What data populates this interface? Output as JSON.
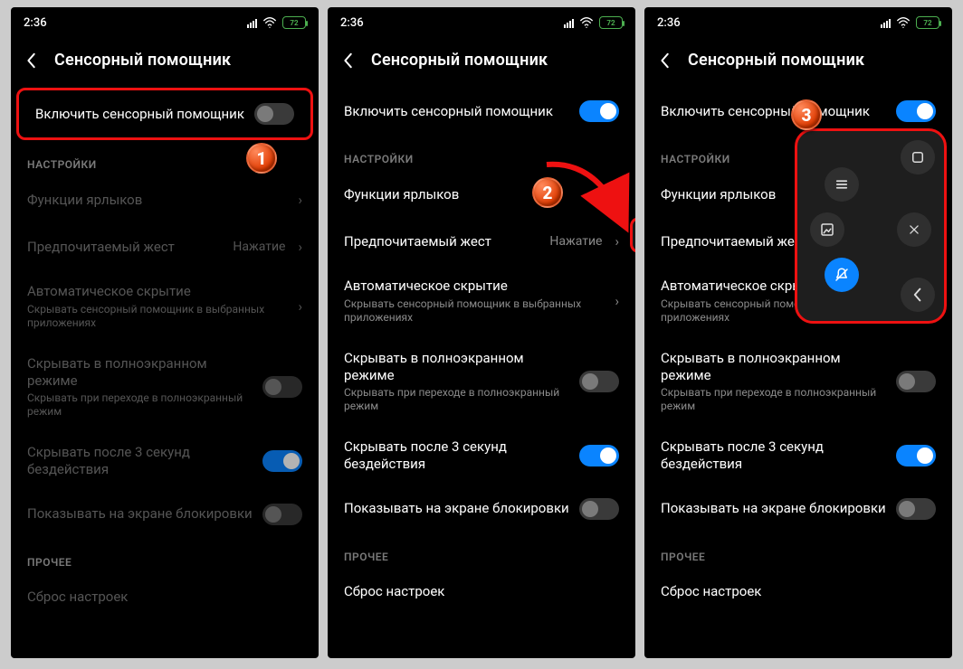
{
  "status": {
    "time": "2:36",
    "battery": "72"
  },
  "header": {
    "title": "Сенсорный помощник"
  },
  "enable": {
    "label": "Включить сенсорный помощник"
  },
  "sections": {
    "settings": "НАСТРОЙКИ",
    "other": "ПРОЧЕЕ"
  },
  "rows": {
    "shortcuts": {
      "label": "Функции ярлыков"
    },
    "gesture": {
      "label": "Предпочитаемый жест",
      "value": "Нажатие"
    },
    "autohide": {
      "label": "Автоматическое скрытие",
      "sub": "Скрывать сенсорный помощник в выбранных приложениях"
    },
    "fullhide": {
      "label": "Скрывать в полноэкранном режиме",
      "sub": "Скрывать при переходе в полноэкранный режим"
    },
    "idle": {
      "label": "Скрывать после 3 секунд бездействия"
    },
    "lock": {
      "label": "Показывать на экране блокировки"
    },
    "reset": {
      "label": "Сброс настроек"
    }
  },
  "badges": {
    "b1": "1",
    "b2": "2",
    "b3": "3"
  }
}
